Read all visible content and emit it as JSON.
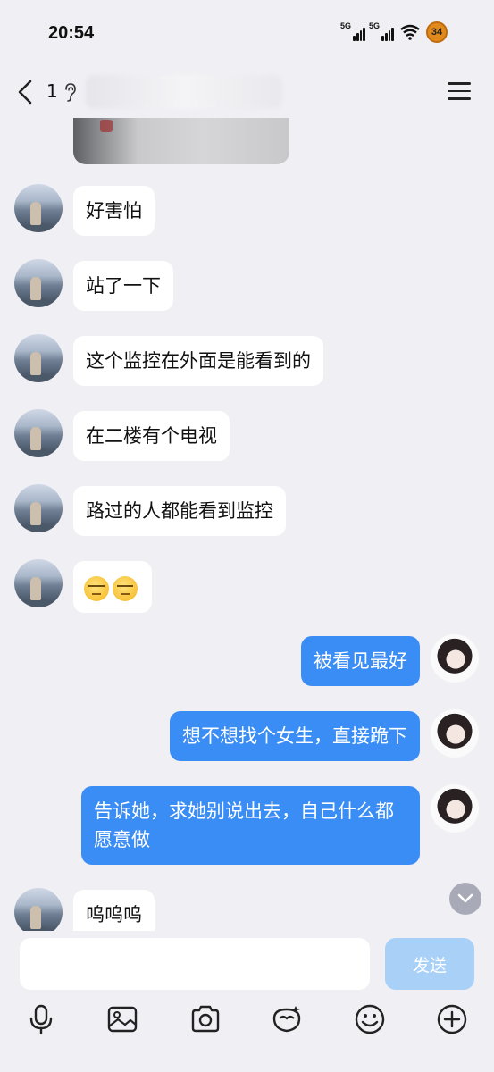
{
  "status_bar": {
    "time": "20:54",
    "signal1_label": "5G",
    "signal2_label": "5G",
    "battery": "34"
  },
  "header": {
    "title": "1",
    "icons": [
      "back-icon",
      "ear-icon",
      "menu-icon"
    ]
  },
  "messages": [
    {
      "side": "in",
      "text": "好害怕"
    },
    {
      "side": "in",
      "text": "站了一下"
    },
    {
      "side": "in",
      "text": "这个监控在外面是能看到的"
    },
    {
      "side": "in",
      "text": "在二楼有个电视"
    },
    {
      "side": "in",
      "text": "路过的人都能看到监控"
    },
    {
      "side": "in",
      "emoji": [
        "unamused-face",
        "unamused-face"
      ]
    },
    {
      "side": "out",
      "text": "被看见最好"
    },
    {
      "side": "out",
      "text": "想不想找个女生，直接跪下"
    },
    {
      "side": "out",
      "text": "告诉她，求她别说出去，自己什么都愿意做"
    },
    {
      "side": "in",
      "text": "呜呜呜"
    }
  ],
  "composer": {
    "placeholder": "",
    "send_label": "发送"
  },
  "toolbar": {
    "icons": [
      "microphone-icon",
      "image-icon",
      "camera-icon",
      "red-packet-icon",
      "emoji-icon",
      "plus-icon"
    ]
  }
}
